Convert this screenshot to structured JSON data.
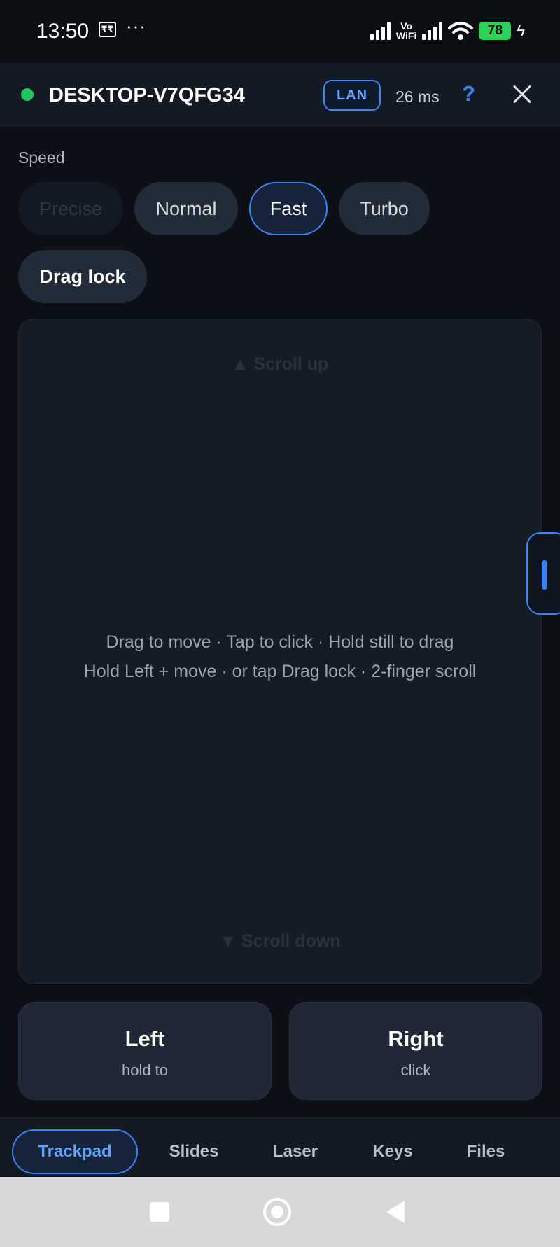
{
  "status_bar": {
    "time": "13:50",
    "rupee_icon_label": "₹₹",
    "more_dots": "···",
    "vowifi_line1": "Vo",
    "vowifi_line2": "WiFi",
    "battery_level": "78",
    "colors": {
      "battery": "#2fd159"
    }
  },
  "header": {
    "connection_status": "connected",
    "device_name": "DESKTOP-V7QFG34",
    "network_badge": "LAN",
    "latency": "26 ms",
    "help_label": "?",
    "colors": {
      "status_dot": "#22c55e",
      "accent": "#3b82f6"
    }
  },
  "speed": {
    "label": "Speed",
    "options": [
      "Precise",
      "Normal",
      "Fast",
      "Turbo"
    ],
    "selected": "Fast",
    "disabled": [
      "Precise"
    ],
    "drag_lock_label": "Drag lock"
  },
  "trackpad": {
    "scroll_up": "▲ Scroll up",
    "scroll_down": "▼ Scroll down",
    "hint_line1": "Drag to move · Tap to click · Hold still to drag",
    "hint_line2": "Hold Left + move · or tap Drag lock · 2-finger scroll"
  },
  "mouse_buttons": {
    "left": {
      "label": "Left",
      "sub": "hold to"
    },
    "right": {
      "label": "Right",
      "sub": "click"
    }
  },
  "tabs": {
    "items": [
      "Trackpad",
      "Slides",
      "Laser",
      "Keys",
      "Files"
    ],
    "active": "Trackpad"
  },
  "system_nav": {
    "icons": [
      "recents-square-icon",
      "home-circle-icon",
      "back-triangle-icon"
    ]
  }
}
